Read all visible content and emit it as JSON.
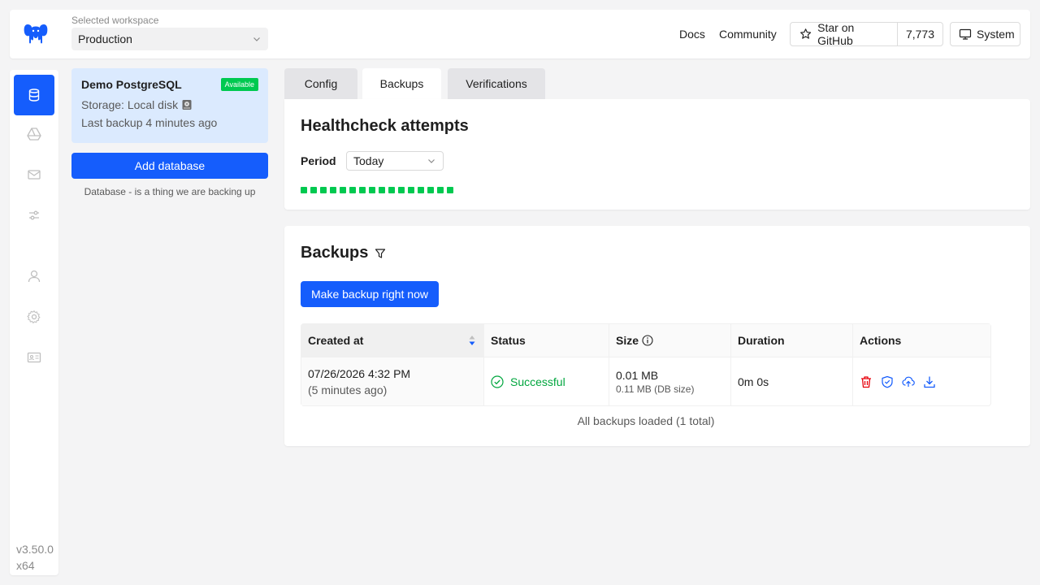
{
  "header": {
    "workspace_label": "Selected workspace",
    "workspace_value": "Production",
    "links": {
      "docs": "Docs",
      "community": "Community"
    },
    "github": {
      "label": "Star on GitHub",
      "count": "7,773"
    },
    "theme": {
      "label": "System"
    }
  },
  "sidebar": {
    "items": [
      {
        "icon": "database-icon",
        "active": true
      },
      {
        "icon": "storage-drive-icon",
        "active": false
      },
      {
        "icon": "mail-icon",
        "active": false
      },
      {
        "icon": "sliders-icon",
        "active": false
      },
      {
        "icon": "user-icon",
        "active": false
      },
      {
        "icon": "gear-icon",
        "active": false
      },
      {
        "icon": "id-card-icon",
        "active": false
      }
    ],
    "version": "v3.50.0",
    "arch": "x64"
  },
  "databases": {
    "selected": {
      "name": "Demo PostgreSQL",
      "badge": "Available",
      "storage": "Storage: Local disk",
      "last_backup": "Last backup 4 minutes ago"
    },
    "add_button": "Add database",
    "hint": "Database - is a thing we are backing up"
  },
  "tabs": [
    {
      "label": "Config",
      "active": false
    },
    {
      "label": "Backups",
      "active": true
    },
    {
      "label": "Verifications",
      "active": false
    }
  ],
  "healthcheck": {
    "title": "Healthcheck attempts",
    "period_label": "Period",
    "period_value": "Today",
    "attempts": 16,
    "success_color": "#00c950"
  },
  "backups": {
    "title": "Backups",
    "make_button": "Make backup right now",
    "columns": {
      "created_at": "Created at",
      "status": "Status",
      "size": "Size",
      "duration": "Duration",
      "actions": "Actions"
    },
    "rows": [
      {
        "created_at": "07/26/2026 4:32 PM",
        "created_ago": "(5 minutes ago)",
        "status": "Successful",
        "size": "0.01 MB",
        "db_size": "0.11 MB (DB size)",
        "duration": "0m 0s"
      }
    ],
    "footer": "All backups loaded (1 total)"
  },
  "colors": {
    "primary": "#155dfc",
    "success": "#00a63e",
    "danger": "#e7000b",
    "selected_bg": "#dbeafe"
  }
}
